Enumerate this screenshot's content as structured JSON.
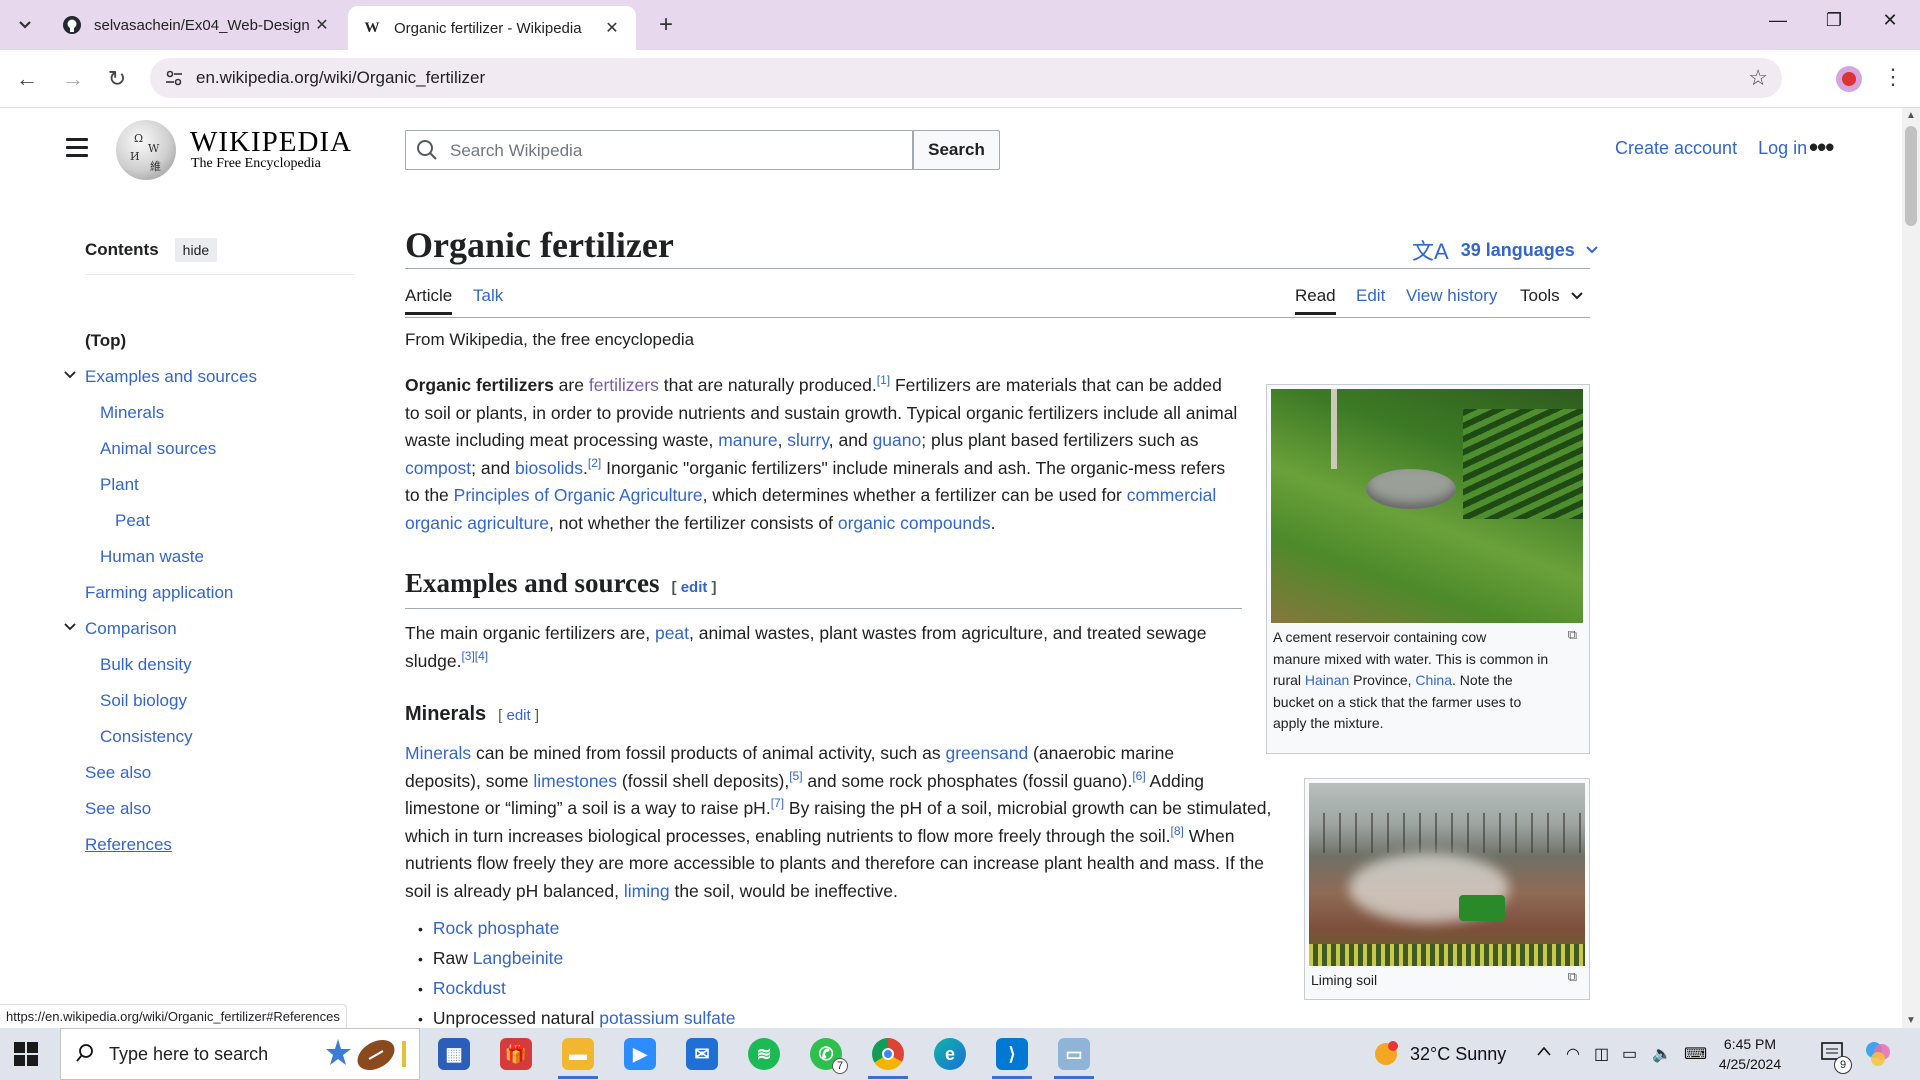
{
  "browser": {
    "tabs": [
      {
        "title": "selvasachein/Ex04_Web-Design",
        "icon": "github-icon",
        "active": false
      },
      {
        "title": "Organic fertilizer - Wikipedia",
        "icon": "wikipedia-icon",
        "active": true
      }
    ],
    "new_tab": "+",
    "url": "en.wikipedia.org/wiki/Organic_fertilizer",
    "status_url": "https://en.wikipedia.org/wiki/Organic_fertilizer#References"
  },
  "wiki": {
    "wordmark": "WIKIPEDIA",
    "tagline": "The Free Encyclopedia",
    "search_placeholder": "Search Wikipedia",
    "search_button": "Search",
    "create_account": "Create account",
    "log_in": "Log in"
  },
  "toc": {
    "title": "Contents",
    "hide": "hide",
    "items": [
      {
        "label": "(Top)"
      },
      {
        "label": "Examples and sources"
      },
      {
        "label": "Minerals"
      },
      {
        "label": "Animal sources"
      },
      {
        "label": "Plant"
      },
      {
        "label": "Peat"
      },
      {
        "label": "Human waste"
      },
      {
        "label": "Farming application"
      },
      {
        "label": "Comparison"
      },
      {
        "label": "Bulk density"
      },
      {
        "label": "Soil biology"
      },
      {
        "label": "Consistency"
      },
      {
        "label": "See also"
      },
      {
        "label": "See also"
      },
      {
        "label": "References"
      }
    ]
  },
  "article": {
    "title": "Organic fertilizer",
    "languages": "39 languages",
    "tabs": {
      "article": "Article",
      "talk": "Talk",
      "read": "Read",
      "edit": "Edit",
      "history": "View history",
      "tools": "Tools"
    },
    "from": "From Wikipedia, the free encyclopedia",
    "intro": {
      "l1a": "Organic fertilizers",
      "l1b": " are ",
      "l1c": "fertilizers",
      "l1d": " that are naturally produced.",
      "ref1": "[1]",
      "l1e": " Fertilizers are materials that can be added",
      "l2": "to soil or plants, in order to provide nutrients and sustain growth. Typical organic fertilizers include all animal",
      "l3a": "waste including meat processing waste, ",
      "manure": "manure",
      "comma1": ", ",
      "slurry": "slurry",
      "and": ", and ",
      "guano": "guano",
      "l3b": "; plus plant based fertilizers such as",
      "compost": "compost",
      "l4a": "; and ",
      "biosolids": "biosolids",
      "l4b": ".",
      "ref2": "[2]",
      "l4c": " Inorganic \"organic fertilizers\" include minerals and ash. The organic-mess refers",
      "l5a": "to the ",
      "principles": "Principles of Organic Agriculture",
      "l5b": ", which determines whether a fertilizer can be used for ",
      "commercial": "commercial",
      "organic_ag": "organic agriculture",
      "l6a": ", not whether the fertilizer consists of ",
      "compounds": "organic compounds",
      "l6b": "."
    },
    "sec1": {
      "heading": "Examples and sources",
      "edit": "[ edit ]",
      "l1a": "The main organic fertilizers are, ",
      "peat": "peat",
      "l1b": ", animal wastes, plant wastes from agriculture, and treated sewage",
      "l2": "sludge.",
      "ref": "[3][4]"
    },
    "sec2": {
      "heading": "Minerals",
      "edit": "[ edit ]",
      "minerals": "Minerals",
      "l1a": " can be mined from fossil products of animal activity, such as ",
      "greensand": "greensand",
      "l1b": " (anaerobic marine",
      "l2a": "deposits), some ",
      "limestones": "limestones",
      "l2b": " (fossil shell deposits),",
      "ref5": "[5]",
      "l2c": " and some rock phosphates (fossil guano).",
      "ref6": "[6]",
      "l2d": " Adding",
      "l3a": "limestone or “liming” a soil is a way to raise pH.",
      "ref7": "[7]",
      "l3b": " By raising the pH of a soil, microbial growth can be stimulated,",
      "l4a": "which in turn increases biological processes, enabling nutrients to flow more freely through the soil.",
      "ref8": "[8]",
      "l4b": " When",
      "l5": "nutrients flow freely they are more accessible to plants and therefore can increase plant health and mass. If the",
      "l6a": "soil is already pH balanced, ",
      "liming": "liming",
      "l6b": " the soil, would be ineffective.",
      "bullets": [
        {
          "pre": "",
          "link": "Rock phosphate"
        },
        {
          "pre": "Raw ",
          "link": "Langbeinite"
        },
        {
          "pre": "",
          "link": "Rockdust"
        },
        {
          "pre": "Unprocessed natural ",
          "link": "potassium sulfate"
        }
      ]
    },
    "fig1": {
      "caption_a": "A cement reservoir containing cow",
      "caption_b": "manure mixed with water. This is common in",
      "caption_c1": "rural ",
      "hainan": "Hainan",
      "caption_c2": " Province, ",
      "china": "China",
      "caption_c3": ". Note the",
      "caption_d": "bucket on a stick that the farmer uses to",
      "caption_e": "apply the mixture."
    },
    "fig2": {
      "caption": "Liming soil"
    }
  },
  "taskbar": {
    "search_placeholder": "Type here to search",
    "weather": "32°C  Sunny",
    "time": "6:45 PM",
    "date": "4/25/2024",
    "notifications": "9",
    "whatsapp_badge": "7"
  }
}
